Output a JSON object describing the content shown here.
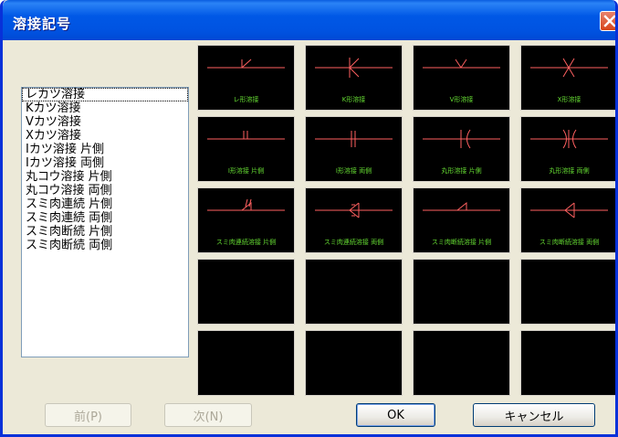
{
  "window": {
    "title": "溶接記号"
  },
  "list": {
    "items": [
      "レカツ溶接",
      "Kカツ溶接",
      "Vカツ溶接",
      "Xカツ溶接",
      "Iカツ溶接 片側",
      "Iカツ溶接 両側",
      "丸コウ溶接 片側",
      "丸コウ溶接 両側",
      "スミ肉連続 片側",
      "スミ肉連続 両側",
      "スミ肉断続 片側",
      "スミ肉断続 両側"
    ]
  },
  "tiles": [
    {
      "label": "レ形溶接",
      "symbol": "bevel"
    },
    {
      "label": "K形溶接",
      "symbol": "k-groove"
    },
    {
      "label": "V形溶接",
      "symbol": "v-groove"
    },
    {
      "label": "X形溶接",
      "symbol": "x-groove"
    },
    {
      "label": "I形溶接 片側",
      "symbol": "i-single"
    },
    {
      "label": "I形溶接 両側",
      "symbol": "i-double"
    },
    {
      "label": "丸形溶接 片側",
      "symbol": "round-single"
    },
    {
      "label": "丸形溶接 両側",
      "symbol": "round-double"
    },
    {
      "label": "スミ肉連続溶接 片側",
      "symbol": "fillet-cont-single"
    },
    {
      "label": "スミ肉連続溶接 両側",
      "symbol": "fillet-cont-double"
    },
    {
      "label": "スミ肉断続溶接 片側",
      "symbol": "fillet-int-single"
    },
    {
      "label": "スミ肉断続溶接 両側",
      "symbol": "fillet-int-double"
    },
    {
      "label": "",
      "symbol": "empty"
    },
    {
      "label": "",
      "symbol": "empty"
    },
    {
      "label": "",
      "symbol": "empty"
    },
    {
      "label": "",
      "symbol": "empty"
    },
    {
      "label": "",
      "symbol": "empty"
    },
    {
      "label": "",
      "symbol": "empty"
    },
    {
      "label": "",
      "symbol": "empty"
    },
    {
      "label": "",
      "symbol": "empty"
    }
  ],
  "buttons": {
    "prev": "前(P)",
    "next": "次(N)",
    "ok": "OK",
    "cancel": "キャンセル"
  },
  "colors": {
    "symbol": "#ff6060",
    "label": "#66dd33",
    "titlebar": "#0058e6"
  }
}
